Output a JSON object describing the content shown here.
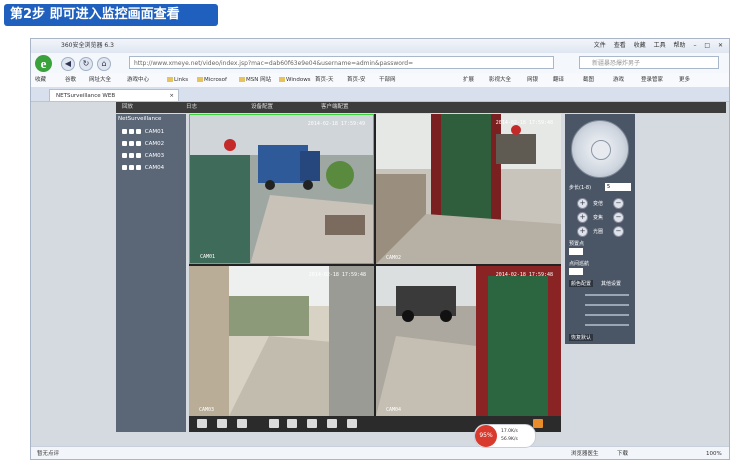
{
  "step": {
    "label": "第2步  即可进入监控画面查看"
  },
  "browser": {
    "title": "360安全浏览器 6.3",
    "menu": [
      "文件",
      "查看",
      "收藏",
      "工具",
      "帮助"
    ],
    "url": "http://www.xmeye.net/video/index.jsp?mac=dab60f63e9e04&username=admin&password=",
    "search_placeholder": "新疆暴恐爆炸男子",
    "favorites": [
      "收藏",
      "谷歌",
      "网址大全",
      "游戏中心",
      "Links",
      "Microsof",
      "MSN 网站",
      "Windows",
      "首页-天",
      "首页-安",
      "干部网",
      "扩展",
      "影视大全",
      "网银",
      "翻译",
      "截图",
      "游戏",
      "登录管家",
      "更多"
    ],
    "tab_label": "NETSurveillance WEB",
    "status_left": "暂无点评",
    "status_right": [
      "浏览器医生",
      "下载",
      "100%"
    ]
  },
  "app": {
    "top_menu": [
      "回放",
      "日志",
      "设备配置",
      "客户端配置"
    ],
    "tree_title": "NetSurveillance",
    "cameras": [
      "CAM01",
      "CAM02",
      "CAM03",
      "CAM04"
    ],
    "feeds": [
      {
        "timestamp": "2014-02-18 17:59:49",
        "label": "CAM01",
        "scene": "truck"
      },
      {
        "timestamp": "2014-02-18 17:59:48",
        "label": "CAM02",
        "scene": "gate"
      },
      {
        "timestamp": "2014-02-18 17:59:48",
        "label": "CAM03",
        "scene": "street"
      },
      {
        "timestamp": "2014-02-18 17:59:48",
        "label": "CAM04",
        "scene": "car"
      }
    ],
    "controls": {
      "step_label": "步长(1-8)",
      "step_value": "5",
      "zoom": "变倍",
      "focus": "变焦",
      "iris": "光圈",
      "preset": "预置点",
      "cruise": "点间巡航",
      "color_tab": "颜色配置",
      "other_tab": "其他设置",
      "default_btn": "恢复默认"
    }
  },
  "speed": {
    "percent": "95%",
    "up": "17.0K/s",
    "down": "56.9K/s"
  }
}
